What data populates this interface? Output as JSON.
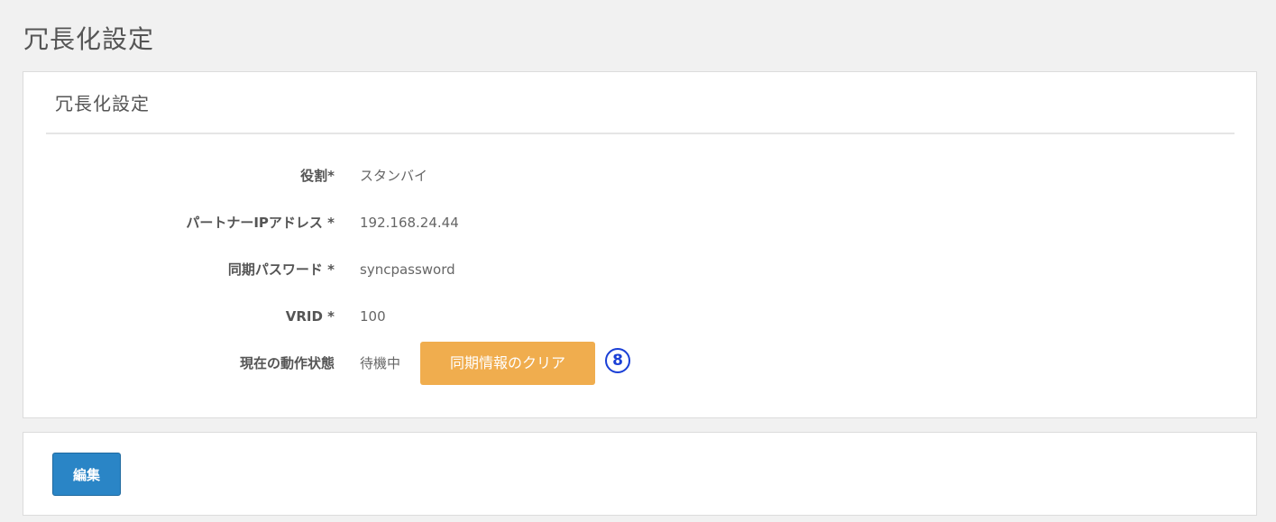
{
  "page": {
    "title": "冗長化設定"
  },
  "panel": {
    "heading": "冗長化設定",
    "fields": [
      {
        "label": "役割*",
        "value": "スタンバイ"
      },
      {
        "label": "パートナーIPアドレス *",
        "value": "192.168.24.44"
      },
      {
        "label": "同期パスワード *",
        "value": "syncpassword"
      },
      {
        "label": "VRID *",
        "value": "100"
      },
      {
        "label": "現在の動作状態",
        "value": "待機中"
      }
    ],
    "clear_button_label": "同期情報のクリア",
    "step_marker": "8"
  },
  "footer": {
    "edit_button_label": "編集"
  },
  "colors": {
    "background": "#f1f1f1",
    "warning_button": "#f0ad4e",
    "primary_button": "#2a85c6",
    "step_marker": "#1a3fd6"
  }
}
